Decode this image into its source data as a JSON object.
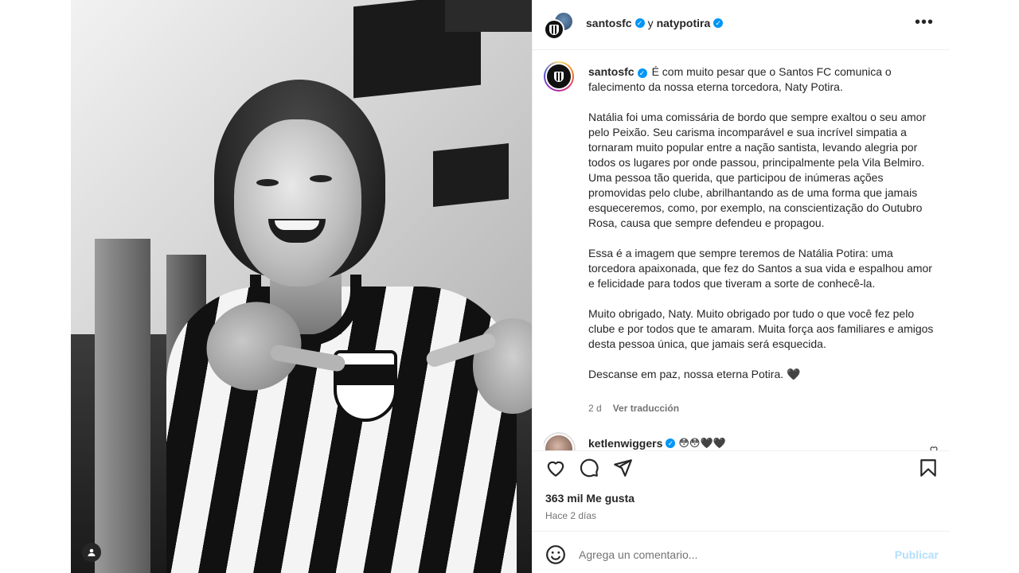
{
  "header": {
    "user1": "santosfc",
    "connector": "y",
    "user2": "natypotira",
    "more_icon": "more-horizontal-icon"
  },
  "caption": {
    "username": "santosfc",
    "paragraphs": [
      "É com muito pesar que o Santos FC comunica o falecimento da nossa eterna torcedora, Naty Potira.",
      "Natália foi uma comissária de bordo que sempre exaltou o seu amor pelo Peixão. Seu carisma incomparável e sua incrível simpatia a tornaram muito popular entre a nação santista, levando alegria por todos os lugares por onde passou, principalmente pela Vila Belmiro. Uma pessoa tão querida, que participou de inúmeras ações promovidas pelo clube, abrilhantando as de uma forma que jamais esqueceremos, como, por exemplo, na conscientização do Outubro Rosa, causa que sempre defendeu e propagou.",
      "Essa é a imagem que sempre teremos de Natália Potira: uma torcedora apaixonada, que fez do Santos a sua vida e espalhou amor e felicidade para todos que tiveram a sorte de conhecê-la.",
      "Muito obrigado, Naty. Muito obrigado por tudo o que você fez pelo clube e por todos que te amaram. Muita força aos familiares e amigos desta pessoa única, que jamais será esquecida.",
      "Descanse em paz, nossa eterna Potira. 🖤"
    ],
    "age": "2 d",
    "translate": "Ver traducción"
  },
  "comment_peek": {
    "username": "ketlenwiggers",
    "emojis": "😳😳🖤🖤"
  },
  "actions": {
    "like_icon": "heart-icon",
    "comment_icon": "comment-icon",
    "share_icon": "share-icon",
    "save_icon": "bookmark-icon"
  },
  "likes": "363 mil Me gusta",
  "time": "Hace 2 días",
  "add_comment": {
    "placeholder": "Agrega un comentario...",
    "publish": "Publicar",
    "emoji_icon": "emoji-icon"
  },
  "colors": {
    "verified": "#0095f6",
    "publish_disabled": "#b2dffc",
    "muted_text": "#737373",
    "border": "#efefef"
  }
}
